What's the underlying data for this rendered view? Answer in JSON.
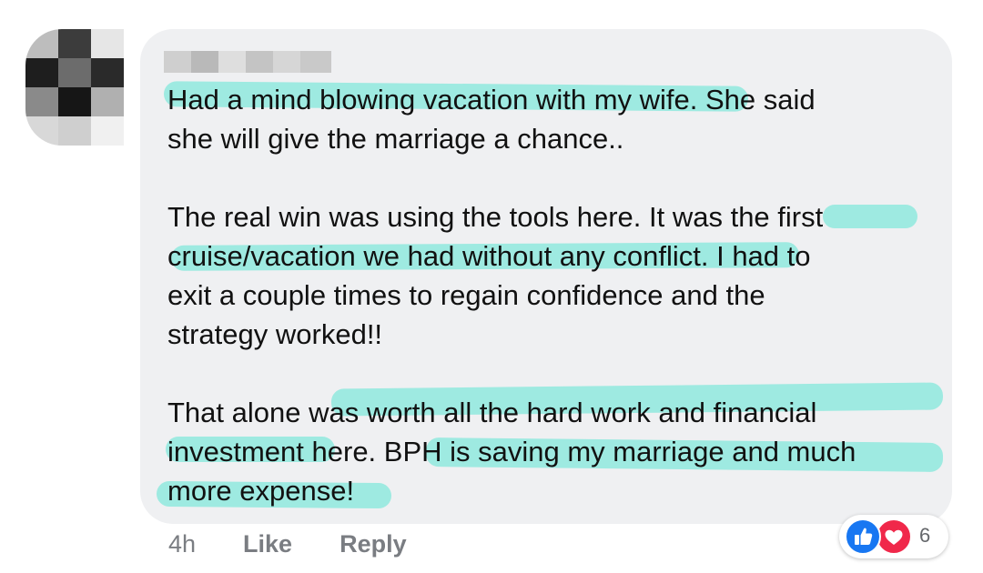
{
  "comment": {
    "author_name_redacted": true,
    "paragraphs": [
      {
        "lines": [
          "Had a mind blowing vacation with my wife. She said",
          "she will give the marriage a chance.."
        ]
      },
      {
        "lines": [
          "The real win was using the tools here. It was the first",
          "cruise/vacation we had without any conflict. I had to",
          "exit a couple times to regain confidence and the",
          "strategy worked!!"
        ]
      },
      {
        "lines": [
          "That alone was worth all the hard work and financial",
          "investment here.  BPH is saving my marriage and much",
          "more expense!"
        ]
      }
    ]
  },
  "actions": {
    "time": "4h",
    "like_label": "Like",
    "reply_label": "Reply"
  },
  "reactions": {
    "icons": [
      "like-icon",
      "love-icon"
    ],
    "count": "6"
  },
  "colors": {
    "highlight": "#7ee8d9",
    "bubble": "#eff0f2",
    "like": "#1877f2",
    "love": "#f0284a"
  }
}
